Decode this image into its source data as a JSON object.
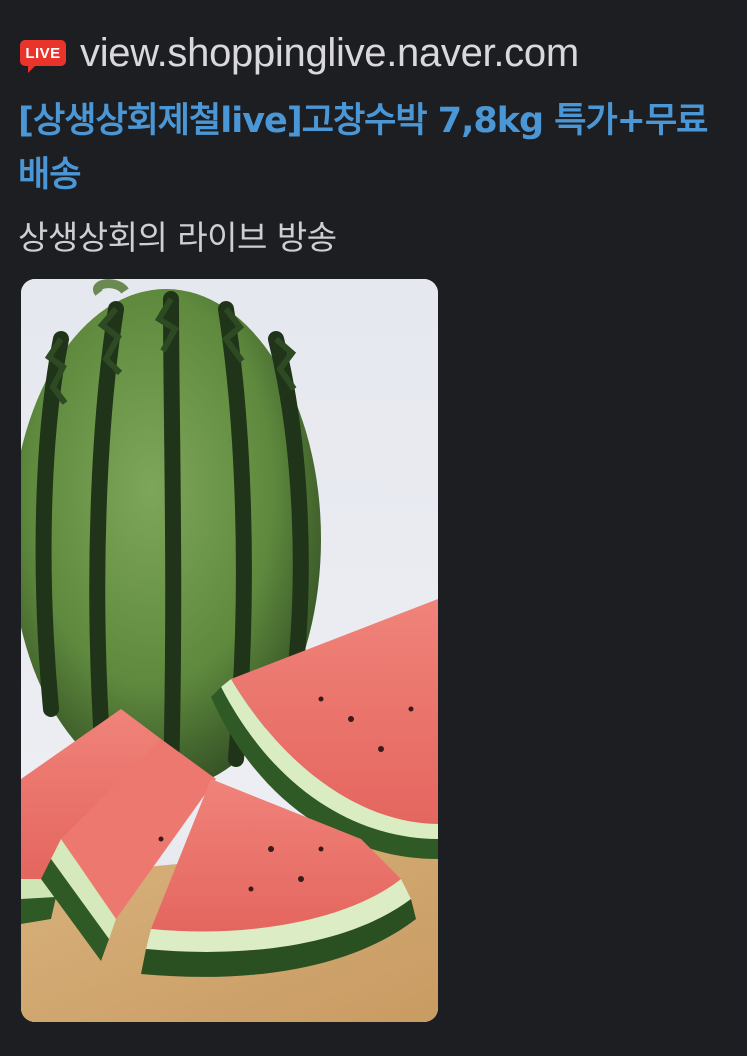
{
  "link_preview": {
    "live_badge": "LIVE",
    "site_domain": "view.shoppinglive.naver.com",
    "title": "[상생상회제철live]고창수박 7,8kg 특가+무료배송",
    "description": "상생상회의 라이브 방송",
    "thumbnail_subject": "watermelon-photo"
  },
  "colors": {
    "background": "#1d1e22",
    "title_link": "#4b97d6",
    "domain_text": "#d9d9dd",
    "description_text": "#cfcfd3",
    "live_badge": "#e8342a"
  }
}
